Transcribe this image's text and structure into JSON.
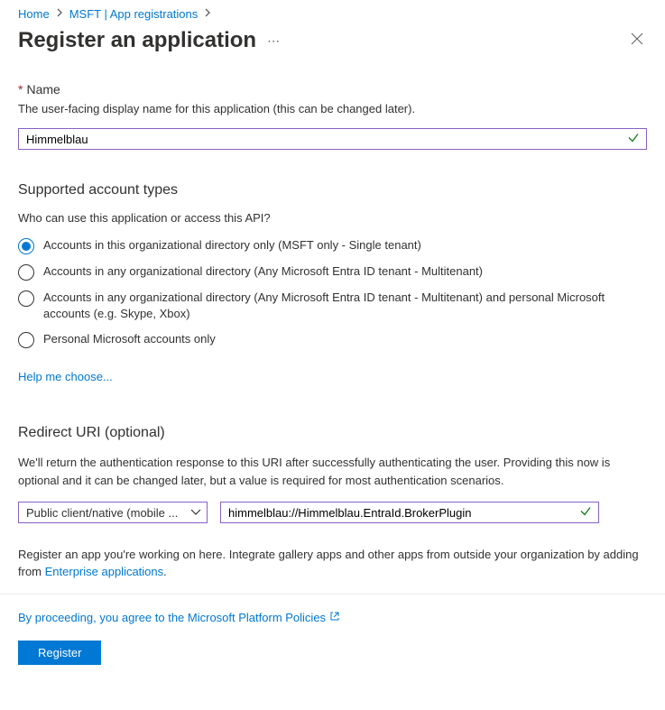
{
  "breadcrumb": {
    "home": "Home",
    "second": "MSFT | App registrations"
  },
  "header": {
    "title": "Register an application"
  },
  "name": {
    "label": "Name",
    "desc": "The user-facing display name for this application (this can be changed later).",
    "value": "Himmelblau"
  },
  "accountTypes": {
    "title": "Supported account types",
    "desc": "Who can use this application or access this API?",
    "options": [
      "Accounts in this organizational directory only (MSFT only - Single tenant)",
      "Accounts in any organizational directory (Any Microsoft Entra ID tenant - Multitenant)",
      "Accounts in any organizational directory (Any Microsoft Entra ID tenant - Multitenant) and personal Microsoft accounts (e.g. Skype, Xbox)",
      "Personal Microsoft accounts only"
    ],
    "helpLink": "Help me choose..."
  },
  "redirect": {
    "title": "Redirect URI (optional)",
    "desc": "We'll return the authentication response to this URI after successfully authenticating the user. Providing this now is optional and it can be changed later, but a value is required for most authentication scenarios.",
    "platform": "Public client/native (mobile ...",
    "uri": "himmelblau://Himmelblau.EntraId.BrokerPlugin"
  },
  "footer": {
    "text_before": "Register an app you're working on here. Integrate gallery apps and other apps from outside your organization by adding from ",
    "link": "Enterprise applications",
    "text_after": ".",
    "policy": "By proceeding, you agree to the Microsoft Platform Policies",
    "register": "Register"
  }
}
